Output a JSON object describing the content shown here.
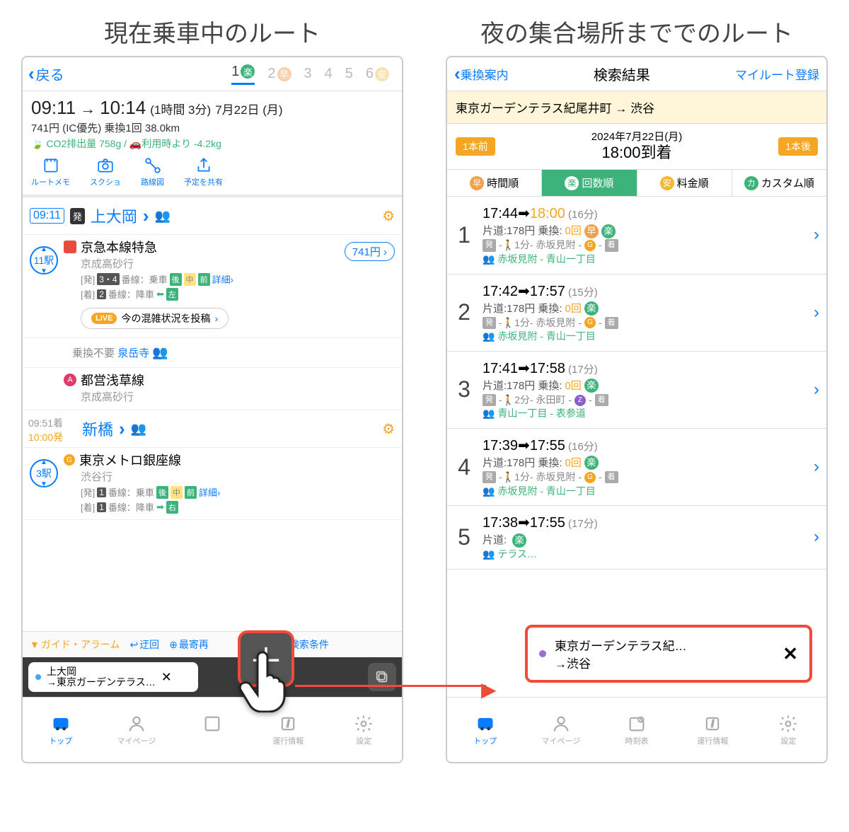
{
  "titles": {
    "left": "現在乗車中のルート",
    "right": "夜の集合場所まででのルート"
  },
  "left": {
    "back": "戻る",
    "tabs": [
      "1",
      "2",
      "3",
      "4",
      "5",
      "6"
    ],
    "summary": {
      "t1": "09:11",
      "arrow": "→",
      "t2": "10:14",
      "dur": "(1時間 3分)",
      "date": "7月22日 (月)",
      "line2": "741円 (IC優先) 乗換1回 38.0km",
      "co2": "CO2排出量 758g / 🚗利用時より -4.2kg"
    },
    "tools": {
      "memo": "ルートメモ",
      "shot": "スクショ",
      "map": "路線図",
      "share": "予定を共有"
    },
    "sta1": {
      "time": "09:11",
      "tag": "発",
      "name": "上大岡"
    },
    "seg1": {
      "stops": "11駅",
      "line": "京急本線特急",
      "dest": "京成高砂行",
      "fare": "741円",
      "plat_dep_label": "[発]",
      "plat_dep": "3・4",
      "plat_dep_txt": "番線：乗車",
      "pos1": "後",
      "pos2": "中",
      "pos3": "前",
      "detail": "詳細",
      "plat_arr_label": "[着]",
      "plat_arr": "2",
      "plat_arr_txt": "番線：降車",
      "pos4": "左",
      "live_badge": "LIVE",
      "live_txt": "今の混雑状況を投稿"
    },
    "transfer": {
      "label": "乗換不要",
      "station": "泉岳寺"
    },
    "seg1b": {
      "line": "都営浅草線",
      "dest": "京成高砂行"
    },
    "sta2": {
      "arr": "09:51着",
      "dep": "10:00発",
      "name": "新橋"
    },
    "seg2": {
      "stops": "3駅",
      "line": "東京メトロ銀座線",
      "dest": "渋谷行",
      "plat_dep_label": "[発]",
      "plat_dep": "1",
      "plat_dep_txt": "番線：乗車",
      "pos1": "後",
      "pos2": "中",
      "pos3": "前",
      "detail": "詳細",
      "plat_arr_label": "[着]",
      "plat_arr": "1",
      "plat_arr_txt": "番線：降車",
      "pos4": "右"
    },
    "btm": {
      "alarm": "ガイド・アラーム",
      "detour": "迂回",
      "rerun": "最寄再",
      "cond": "検索条件"
    },
    "bbar": {
      "from": "上大岡",
      "to": "→東京ガーデンテラス…"
    },
    "tabbar": {
      "top": "トップ",
      "mypage": "マイページ",
      "live": "運行情報",
      "set": "設定"
    }
  },
  "right": {
    "back": "乗換案内",
    "title": "検索結果",
    "reg": "マイルート登録",
    "query": "東京ガーデンテラス紀尾井町 → 渋谷",
    "date": {
      "prev": "1本前",
      "d1": "2024年7月22日(月)",
      "d2": "18:00到着",
      "next": "1本後"
    },
    "sort": {
      "time": "時間順",
      "count": "回数順",
      "fare": "料金順",
      "custom": "カスタム順"
    },
    "results": [
      {
        "n": "1",
        "t1": "17:44",
        "t2": "18:00",
        "dur": "(16分)",
        "fare": "片道:178円 乗換:",
        "tr": "0回",
        "walk": "1分",
        "sta": "赤坂見附",
        "via": "赤坂見附 - 青山一丁目",
        "line_ic": "g",
        "haya": true
      },
      {
        "n": "2",
        "t1": "17:42",
        "t2": "17:57",
        "dur": "(15分)",
        "fare": "片道:178円 乗換:",
        "tr": "0回",
        "walk": "1分",
        "sta": "赤坂見附",
        "via": "赤坂見附 - 青山一丁目",
        "line_ic": "g",
        "haya": false
      },
      {
        "n": "3",
        "t1": "17:41",
        "t2": "17:58",
        "dur": "(17分)",
        "fare": "片道:178円 乗換:",
        "tr": "0回",
        "walk": "2分",
        "sta": "永田町",
        "via": "青山一丁目 - 表参道",
        "line_ic": "z",
        "haya": false
      },
      {
        "n": "4",
        "t1": "17:39",
        "t2": "17:55",
        "dur": "(16分)",
        "fare": "片道:178円 乗換:",
        "tr": "0回",
        "walk": "1分",
        "sta": "赤坂見附",
        "via": "赤坂見附 - 青山一丁目",
        "line_ic": "g",
        "haya": false
      },
      {
        "n": "5",
        "t1": "17:38",
        "t2": "17:55",
        "dur": "(17分)",
        "fare": "片道:",
        "tr": "",
        "walk": "",
        "sta": "",
        "via": "テラス…",
        "line_ic": "",
        "haya": false
      }
    ],
    "overlay": {
      "l1": "東京ガーデンテラス紀…",
      "l2": "→渋谷"
    },
    "tabbar": {
      "top": "トップ",
      "mypage": "マイページ",
      "time": "時刻表",
      "live": "運行情報",
      "set": "設定"
    }
  }
}
